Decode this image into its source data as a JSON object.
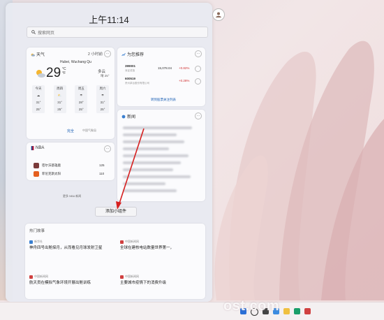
{
  "clock": "上午11:14",
  "search": {
    "placeholder": "搜索网页"
  },
  "weather": {
    "title": "天气",
    "updated": "2 小时前",
    "location": "Hubei, Wuchang Qu",
    "temp": "29",
    "unit": "°C",
    "unit_f": "°F",
    "desc": "多云",
    "desc_sub": "晴 25°",
    "forecast": [
      {
        "day": "今天",
        "high": "31°",
        "low": "25°"
      },
      {
        "day": "周四",
        "high": "31°",
        "low": "25°"
      },
      {
        "day": "周五",
        "high": "28°",
        "low": "25°"
      },
      {
        "day": "周六",
        "high": "31°",
        "low": "25°"
      }
    ],
    "link": "完全",
    "source": "中国气象局"
  },
  "stocks": {
    "title": "为您推荐",
    "rows": [
      {
        "symbol": "399001",
        "name": "深证成指",
        "price": "15,078.04",
        "change": "+0.82%"
      },
      {
        "symbol": "600519",
        "name": "贵州茅台股份有限公司",
        "price": "",
        "change": "+0.28%"
      }
    ],
    "link": "转到股票关注列表"
  },
  "nba": {
    "title": "NBA",
    "rows": [
      {
        "team": "密尔沃基雄鹿",
        "score": "125"
      },
      {
        "team": "菲尼克斯太阳",
        "score": "110"
      }
    ],
    "link": "更多 NBA 新闻"
  },
  "news": {
    "title": "新闻"
  },
  "add_widget": "添加小组件",
  "hot": {
    "title": "热门故事",
    "items": [
      {
        "source": "新华社",
        "text": "神舟四号出舱探月，从而看见月球发射卫星"
      },
      {
        "source": "中国新闻网",
        "text": "全球在建核电站数量世界第一，"
      },
      {
        "source": "中国新闻网",
        "text": "航天员在模拟气象环境开展出舱训练"
      },
      {
        "source": "中国新闻网",
        "text": "主要城市疫情下的消费升级"
      }
    ]
  },
  "watermark": "ost.com"
}
